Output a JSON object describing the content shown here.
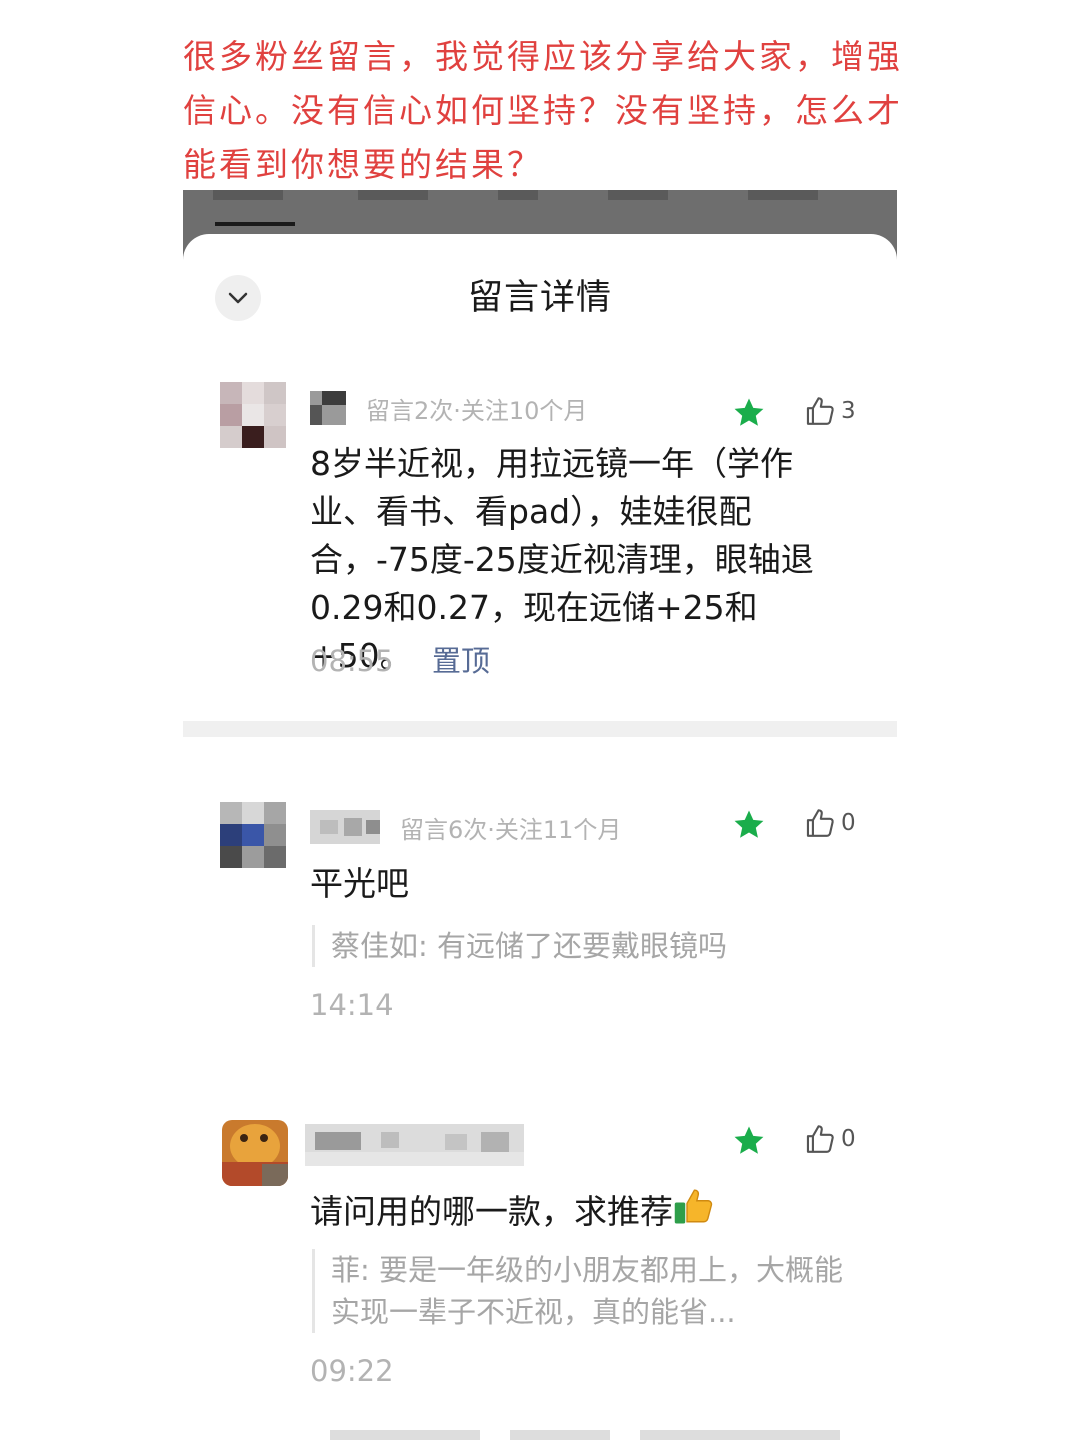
{
  "headline": "很多粉丝留言，我觉得应该分享给大家，增强信心。没有信心如何坚持？没有坚持，怎么才能看到你想要的结果？",
  "sheet": {
    "title": "留言详情",
    "collapse_icon": "chevron-down-icon"
  },
  "colors": {
    "headline": "#e0413f",
    "star": "#1aad4b",
    "pin_link": "#576b95",
    "muted": "#b3b3b3"
  },
  "comments": [
    {
      "meta": "留言2次·关注10个月",
      "likes": "3",
      "starred": true,
      "text": "8岁半近视，用拉远镜一年（学作业、看书、看pad），娃娃很配合，-75度-25度近视清理，眼轴退0.29和0.27，现在远储+25和+50。",
      "time": "08:55",
      "pin_label": "置顶"
    },
    {
      "meta": "留言6次·关注11个月",
      "likes": "0",
      "starred": true,
      "text": "平光吧",
      "quote": "蔡佳如: 有远储了还要戴眼镜吗",
      "time": "14:14"
    },
    {
      "meta": "",
      "likes": "0",
      "starred": true,
      "text": "请问用的哪一款，求推荐",
      "emoji": "thumbs-up-emoji",
      "quote": "菲: 要是一年级的小朋友都用上，大概能实现一辈子不近视，真的能省...",
      "time": "09:22"
    }
  ]
}
